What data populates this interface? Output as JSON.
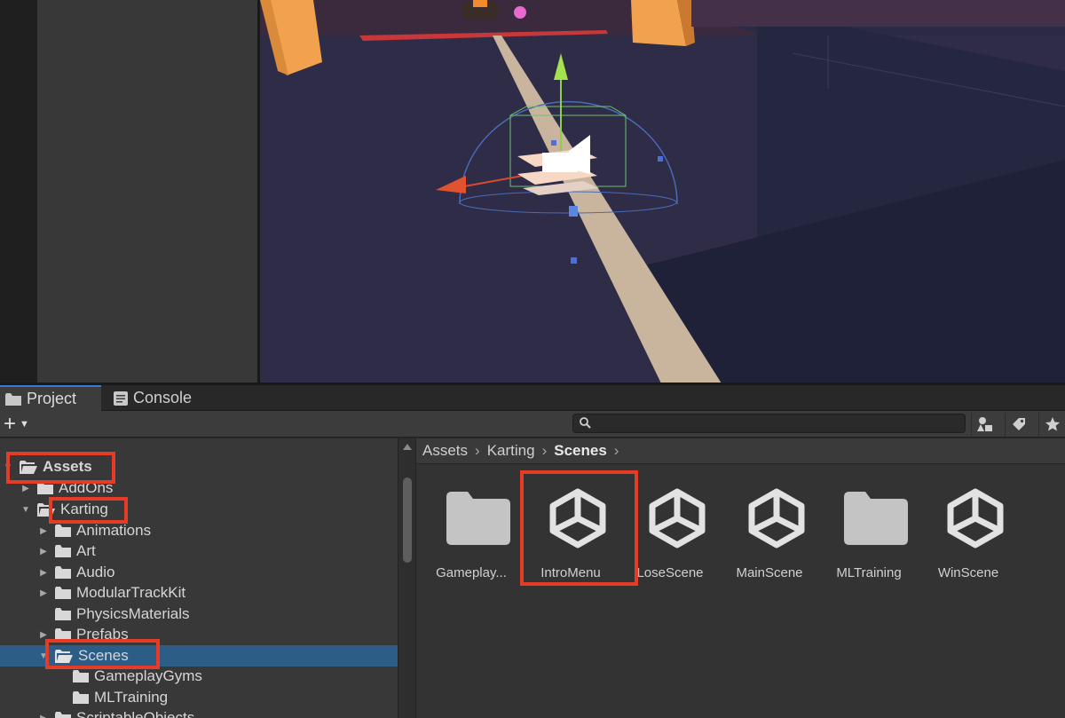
{
  "tabs": [
    {
      "label": "Project",
      "icon": "folder-icon",
      "active": true
    },
    {
      "label": "Console",
      "icon": "console-icon",
      "active": false
    }
  ],
  "toolbar": {
    "create_label": "+",
    "search_placeholder": "",
    "icons": [
      "asset-type-filter-icon",
      "label-filter-icon",
      "favorites-star-icon"
    ]
  },
  "tree": {
    "root": "Assets",
    "items": [
      {
        "label": "AddOns",
        "depth": 1,
        "expandable": true,
        "expanded": false
      },
      {
        "label": "Karting",
        "depth": 1,
        "expandable": true,
        "expanded": true
      },
      {
        "label": "Animations",
        "depth": 2,
        "expandable": true,
        "expanded": false
      },
      {
        "label": "Art",
        "depth": 2,
        "expandable": true,
        "expanded": false
      },
      {
        "label": "Audio",
        "depth": 2,
        "expandable": true,
        "expanded": false
      },
      {
        "label": "ModularTrackKit",
        "depth": 2,
        "expandable": true,
        "expanded": false
      },
      {
        "label": "PhysicsMaterials",
        "depth": 2,
        "expandable": false,
        "expanded": false
      },
      {
        "label": "Prefabs",
        "depth": 2,
        "expandable": true,
        "expanded": false
      },
      {
        "label": "Scenes",
        "depth": 2,
        "expandable": true,
        "expanded": true,
        "selected": true
      },
      {
        "label": "GameplayGyms",
        "depth": 3,
        "expandable": false,
        "expanded": false
      },
      {
        "label": "MLTraining",
        "depth": 3,
        "expandable": false,
        "expanded": false
      },
      {
        "label": "ScriptableObjects",
        "depth": 2,
        "expandable": true,
        "expanded": false
      }
    ]
  },
  "breadcrumb": [
    "Assets",
    "Karting",
    "Scenes"
  ],
  "assets": [
    {
      "label": "Gameplay...",
      "kind": "folder"
    },
    {
      "label": "IntroMenu",
      "kind": "scene"
    },
    {
      "label": "LoseScene",
      "kind": "scene"
    },
    {
      "label": "MainScene",
      "kind": "scene"
    },
    {
      "label": "MLTraining",
      "kind": "folder"
    },
    {
      "label": "WinScene",
      "kind": "scene"
    }
  ],
  "colors": {
    "highlight": "#e53b27",
    "selection": "#2c5d87",
    "active_tab_accent": "#3a7ad6"
  }
}
